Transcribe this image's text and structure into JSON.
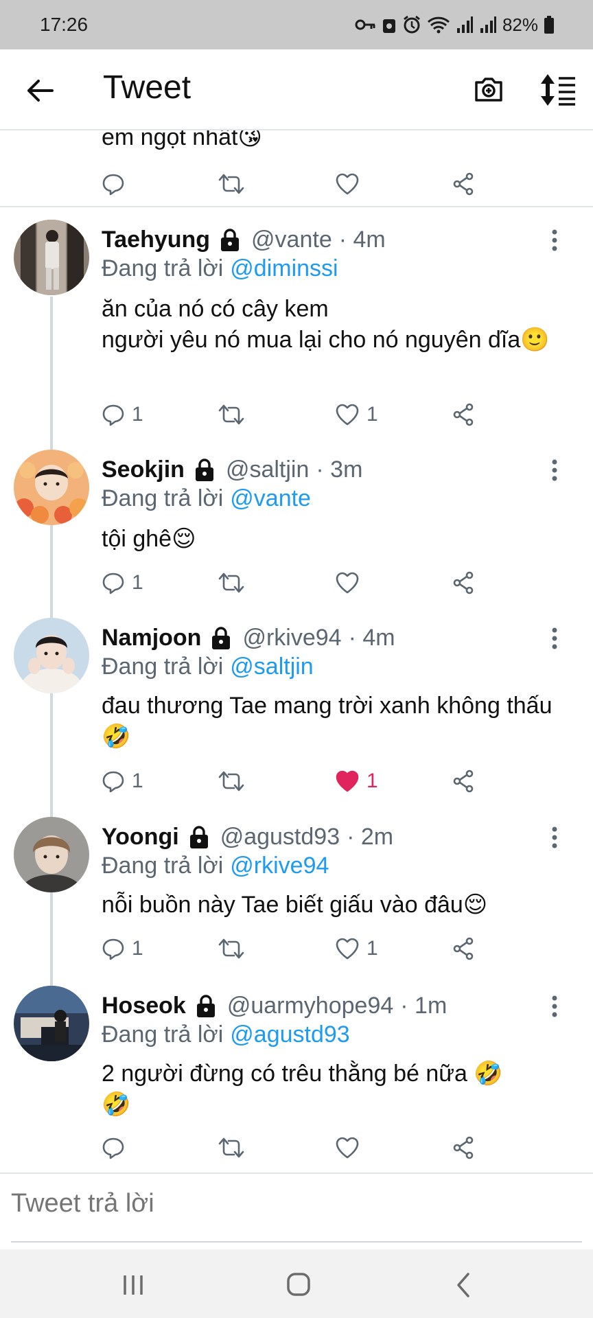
{
  "status_bar": {
    "time": "17:26",
    "battery": "82%",
    "icons": [
      "vpn-key-icon",
      "lock-badge-icon",
      "alarm-icon",
      "wifi-icon",
      "signal-icon",
      "signal-icon-2",
      "battery-icon"
    ]
  },
  "app_bar": {
    "title": "Tweet",
    "back_icon": "arrow-left-icon",
    "camera_icon": "camera-plus-icon",
    "sort_icon": "sort-lines-icon"
  },
  "partial_tweet": {
    "text": "em ngọt nhất😘"
  },
  "colors": {
    "accent": "#1d9bf0",
    "like_active": "#e0245e",
    "muted": "#5b6670",
    "divider": "#e1e5e8",
    "status_bar_bg": "#c9c9c9"
  },
  "replying_label": "Đang trả lời",
  "tweets": [
    {
      "name": "Taehyung",
      "handle": "@vante",
      "time": "· 4m",
      "reply_to": "@diminssi",
      "text": "ăn của nó có cây kem\nngười yêu nó mua lại cho nó nguyên dĩa🙂",
      "reply_count": "1",
      "retweet_count": "",
      "like_count": "1",
      "liked": false
    },
    {
      "name": "Seokjin",
      "handle": "@saltjin",
      "time": "· 3m",
      "reply_to": "@vante",
      "text": "tội ghê😌",
      "reply_count": "1",
      "retweet_count": "",
      "like_count": "",
      "liked": false
    },
    {
      "name": "Namjoon",
      "handle": "@rkive94",
      "time": "· 4m",
      "reply_to": "@saltjin",
      "text": "đau thương Tae mang trời xanh không thấu🤣",
      "reply_count": "1",
      "retweet_count": "",
      "like_count": "1",
      "liked": true
    },
    {
      "name": "Yoongi",
      "handle": "@agustd93",
      "time": "· 2m",
      "reply_to": "@rkive94",
      "text": "nỗi buồn này Tae biết giấu vào đâu😌",
      "reply_count": "1",
      "retweet_count": "",
      "like_count": "1",
      "liked": false
    },
    {
      "name": "Hoseok",
      "handle": "@uarmyhope94",
      "time": "· 1m",
      "reply_to": "@agustd93",
      "text": "2 người đừng có trêu thằng bé nữa 🤣\n🤣",
      "reply_count": "",
      "retweet_count": "",
      "like_count": "",
      "liked": false
    }
  ],
  "reply_bar": {
    "placeholder": "Tweet trả lời"
  },
  "nav_bar": {
    "recents_icon": "recents-icon",
    "home_icon": "home-icon",
    "back_icon": "back-chevron-icon"
  }
}
